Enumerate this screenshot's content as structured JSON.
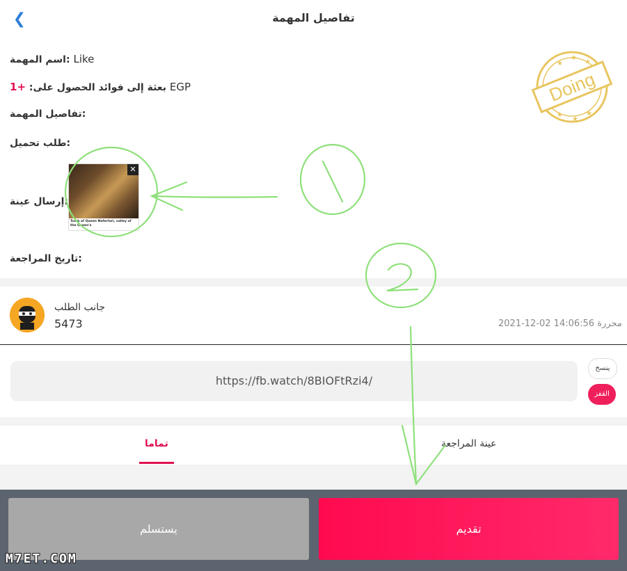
{
  "header": {
    "title": "تفاصيل المهمة",
    "back_icon": "chevron-left-icon"
  },
  "task": {
    "name_label": "اسم المهمة:",
    "name_value": "Like",
    "reward_label": "بعثة إلى فوائد الحصول على:",
    "reward_plus": "+1",
    "reward_currency": "EGP",
    "details_label": "تفاصيل المهمة:",
    "upload_label": "طلب تحميل:",
    "sample_label": "إرسال عينة:",
    "review_date_label": "تاريخ المراجعة:",
    "status_stamp": "Doing",
    "sample_caption": "Tomb of Queen Nefertari, valley of the Queen's"
  },
  "requester": {
    "label": "جانب الطلب",
    "id": "5473",
    "posted": "2021-12-02 14:06:56 محررة"
  },
  "link": {
    "url": "https://fb.watch/8BIOFtRzi4/",
    "copy_label": "ينسخ",
    "open_label": "القفز"
  },
  "tabs": [
    {
      "label": "تماما",
      "active": true
    },
    {
      "label": "عينة المراجعة",
      "active": false
    }
  ],
  "actions": {
    "give_up": "يستسلم",
    "submit": "تقديم"
  },
  "watermark": "M7ET.COM",
  "colors": {
    "accent": "#ef1f5c",
    "link_blue": "#2f7fd6",
    "stamp": "#e8c560",
    "annotation": "#8ee07a"
  }
}
